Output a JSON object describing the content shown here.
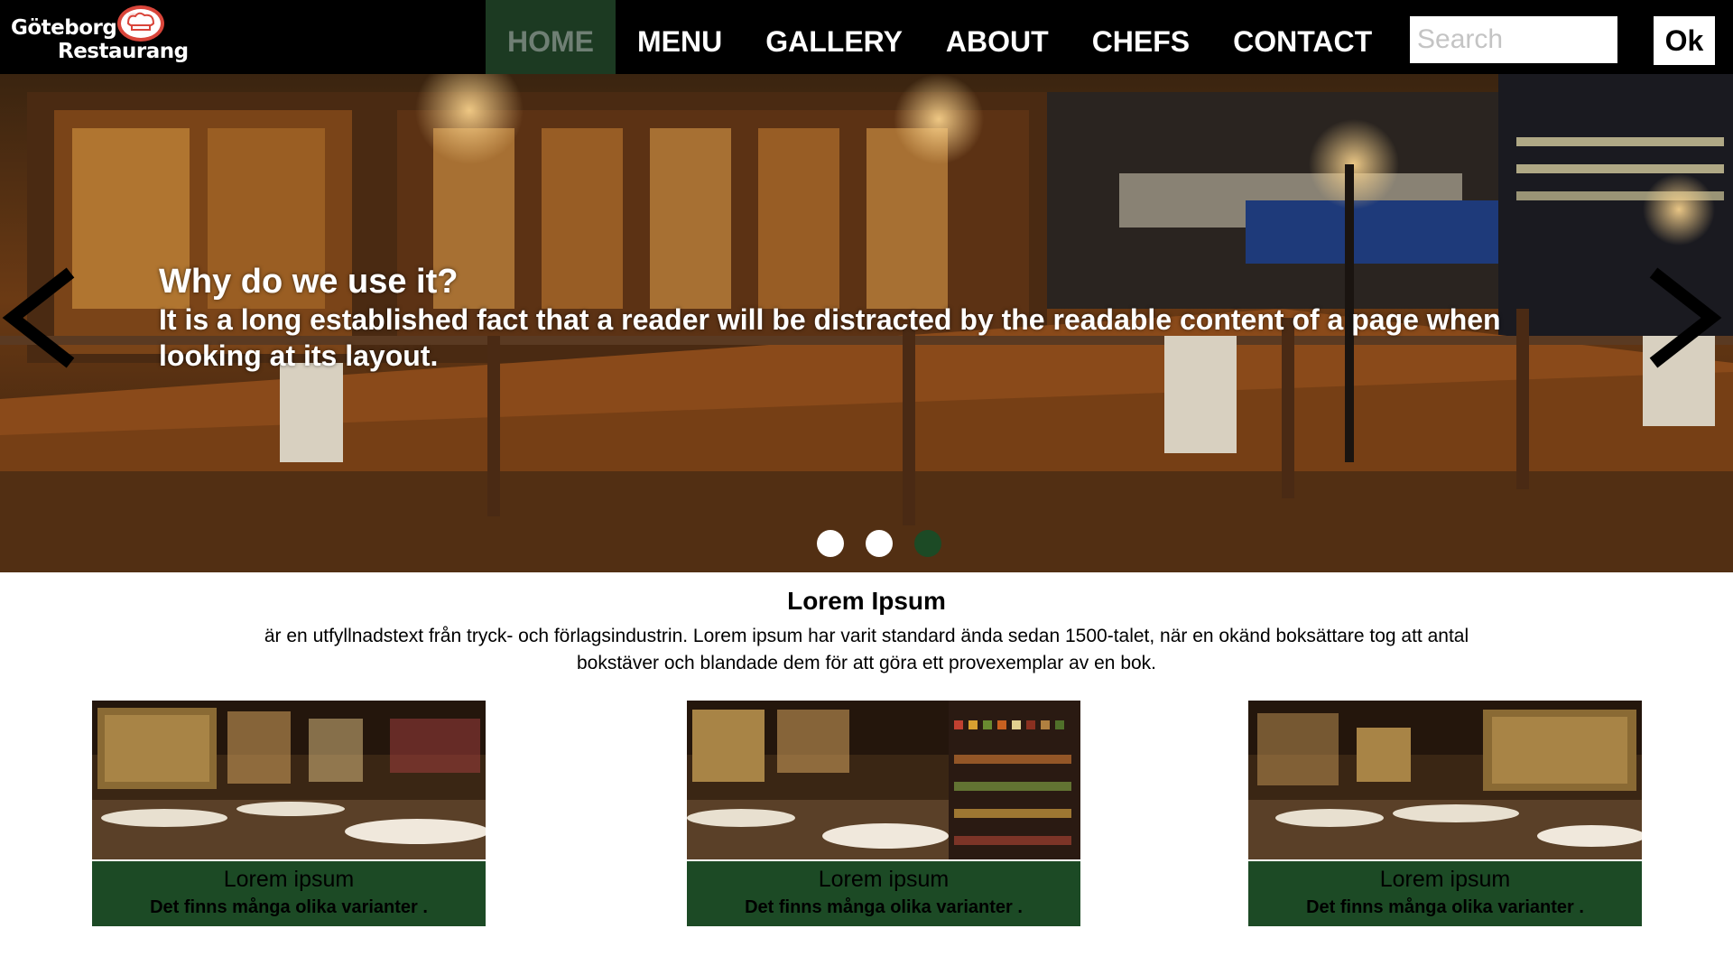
{
  "logo": {
    "line1": "Göteborg",
    "line2": "Restaurang"
  },
  "nav": {
    "items": [
      {
        "label": "HOME",
        "active": true
      },
      {
        "label": "MENU",
        "active": false
      },
      {
        "label": "GALLERY",
        "active": false
      },
      {
        "label": "ABOUT",
        "active": false
      },
      {
        "label": "CHEFS",
        "active": false
      },
      {
        "label": "CONTACT",
        "active": false
      }
    ]
  },
  "search": {
    "placeholder": "Search",
    "value": "",
    "button_label": "Ok"
  },
  "hero": {
    "title": "Why do we use it?",
    "text": "It is a long established fact that a reader will be distracted by the readable content of a page when looking at its layout.",
    "slides": 3,
    "active_slide": 3
  },
  "intro": {
    "title": "Lorem Ipsum",
    "text": "är en utfyllnadstext från tryck- och förlagsindustrin. Lorem ipsum har varit standard ända sedan 1500-talet, när en okänd boksättare tog att antal bokstäver och blandade dem för att göra ett provexemplar av en bok."
  },
  "cards": [
    {
      "title": "Lorem ipsum",
      "text": "Det finns många olika varianter ."
    },
    {
      "title": "Lorem ipsum",
      "text": "Det finns många olika varianter ."
    },
    {
      "title": "Lorem ipsum",
      "text": "Det finns många olika varianter ."
    }
  ],
  "colors": {
    "accent_green": "#1c4a25",
    "nav_bg": "#000000",
    "active_nav_bg": "#1c3a22"
  }
}
